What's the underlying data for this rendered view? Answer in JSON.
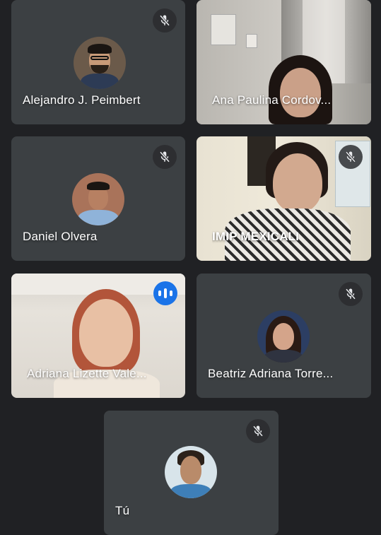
{
  "participants": [
    {
      "name": "Alejandro J. Peimbert",
      "mic": "muted",
      "mode": "avatar"
    },
    {
      "name": "Ana Paulina Cordov...",
      "mic": "unmuted",
      "mode": "video"
    },
    {
      "name": "Daniel Olvera",
      "mic": "muted",
      "mode": "avatar"
    },
    {
      "name": "IMIP MEXICALI",
      "mic": "muted",
      "mode": "video"
    },
    {
      "name": "Adriana Lizette Vale...",
      "mic": "speaking",
      "mode": "video"
    },
    {
      "name": "Beatriz Adriana Torre...",
      "mic": "muted",
      "mode": "avatar"
    },
    {
      "name": "Tú",
      "mic": "muted",
      "mode": "avatar"
    }
  ],
  "icons": {
    "muted": "mic-off-icon",
    "speaking": "audio-level-icon"
  },
  "colors": {
    "background": "#202124",
    "tile": "#3c4043",
    "speaking_accent": "#1a73e8"
  }
}
